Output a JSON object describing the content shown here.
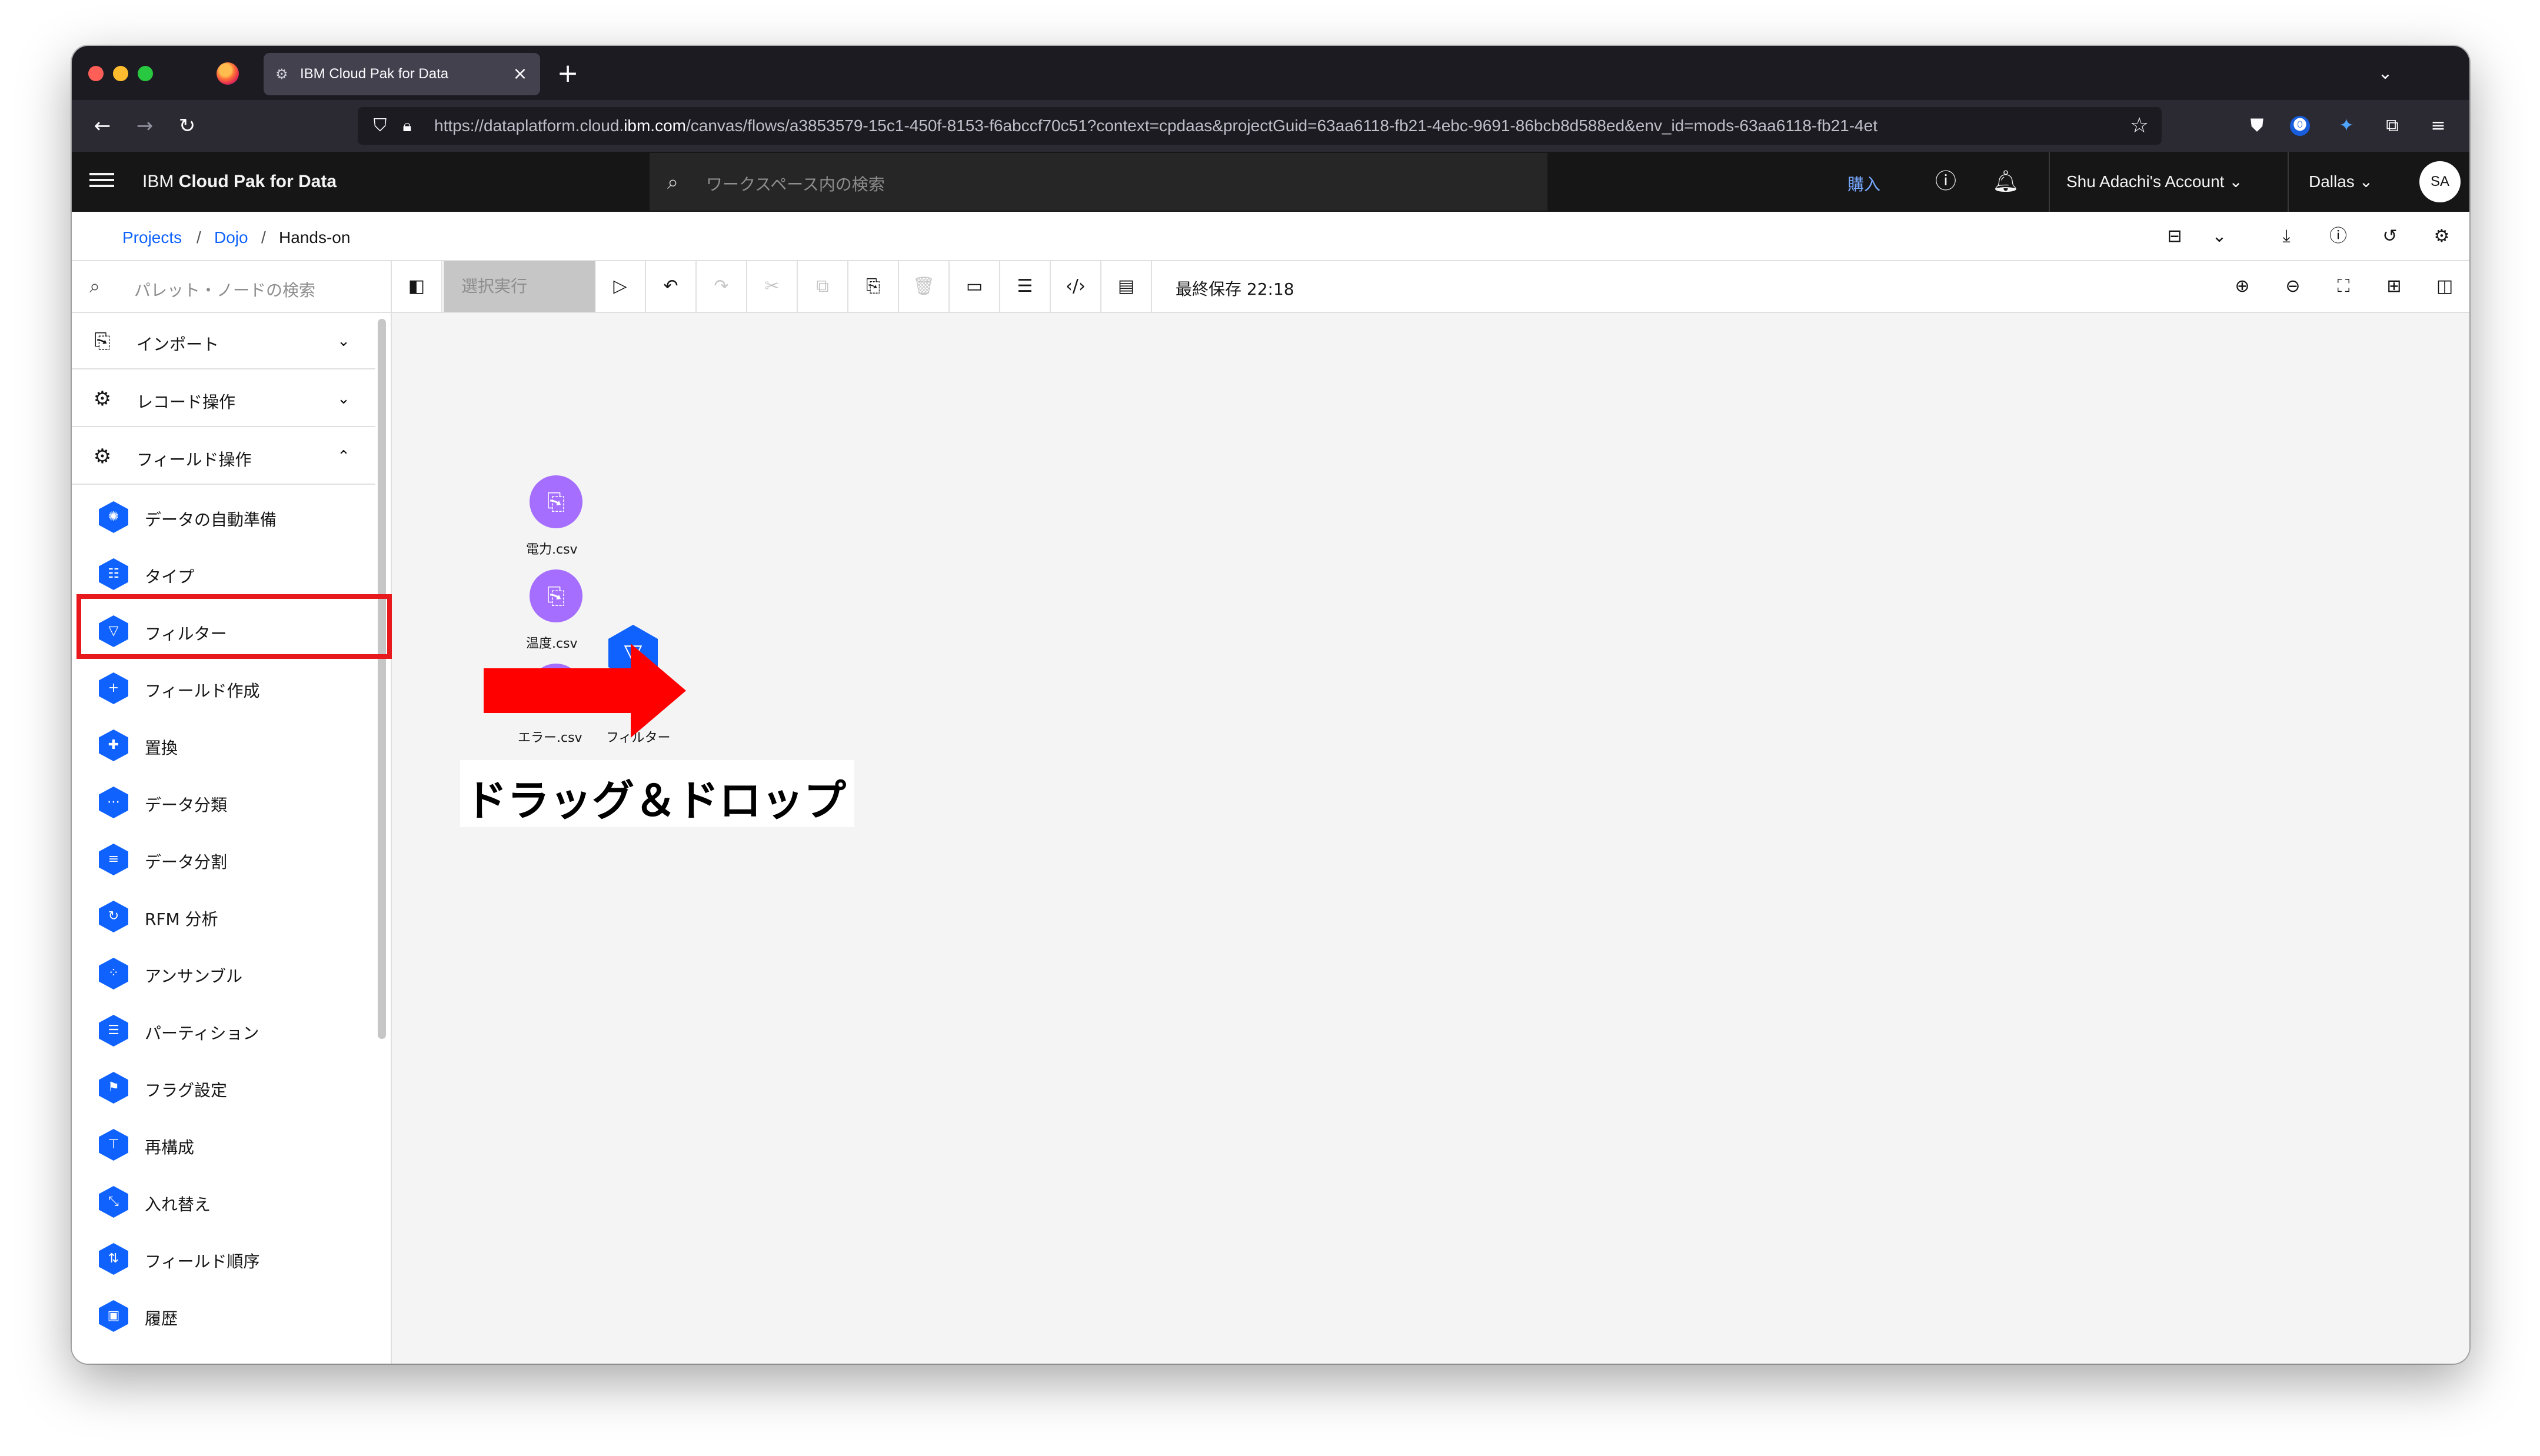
{
  "browser": {
    "tab_title": "IBM Cloud Pak for Data",
    "tab_close": "×",
    "new_tab": "+",
    "url_prefix": "https://dataplatform.cloud.",
    "url_host": "ibm.com",
    "url_suffix": "/canvas/flows/a3853579-15c1-450f-8153-f6abccf70c51?context=cpdaas&projectGuid=63aa6118-fb21-4ebc-9691-86bcb8d588ed&env_id=mods-63aa6118-fb21-4et"
  },
  "header": {
    "brand_prefix": "IBM ",
    "brand_name": "Cloud Pak for Data",
    "search_placeholder": "ワークスペース内の検索",
    "buy_label": "購入",
    "account_label": "Shu Adachi's Account",
    "region_label": "Dallas",
    "avatar_initials": "SA"
  },
  "breadcrumb": {
    "items": [
      "Projects",
      "Dojo",
      "Hands-on"
    ],
    "separator": "/"
  },
  "toolbar": {
    "palette_search_placeholder": "パレット・ノードの検索",
    "run_selection_label": "選択実行",
    "last_saved": "最終保存 22:18"
  },
  "palette": {
    "sections": [
      {
        "label": "インポート",
        "icon": "import-icon",
        "expanded": false
      },
      {
        "label": "レコード操作",
        "icon": "record-ops-icon",
        "expanded": false
      },
      {
        "label": "フィールド操作",
        "icon": "field-ops-icon",
        "expanded": true
      }
    ],
    "nodes": [
      {
        "label": "データの自動準備"
      },
      {
        "label": "タイプ"
      },
      {
        "label": "フィルター"
      },
      {
        "label": "フィールド作成"
      },
      {
        "label": "置換"
      },
      {
        "label": "データ分類"
      },
      {
        "label": "データ分割"
      },
      {
        "label": "RFM 分析"
      },
      {
        "label": "アンサンブル"
      },
      {
        "label": "パーティション"
      },
      {
        "label": "フラグ設定"
      },
      {
        "label": "再構成"
      },
      {
        "label": "入れ替え"
      },
      {
        "label": "フィールド順序"
      },
      {
        "label": "履歴"
      }
    ]
  },
  "canvas": {
    "nodes": [
      {
        "label": "電力.csv",
        "type": "import"
      },
      {
        "label": "温度.csv",
        "type": "import"
      },
      {
        "label": "エラー.csv",
        "type": "import"
      },
      {
        "label": "フィルター",
        "type": "filter"
      }
    ],
    "annotation": "ドラッグ＆ドロップ"
  },
  "colors": {
    "ibm_blue": "#0f62fe",
    "import_purple": "#a56eff",
    "highlight_red": "#e8191d",
    "header_bg": "#161616"
  }
}
